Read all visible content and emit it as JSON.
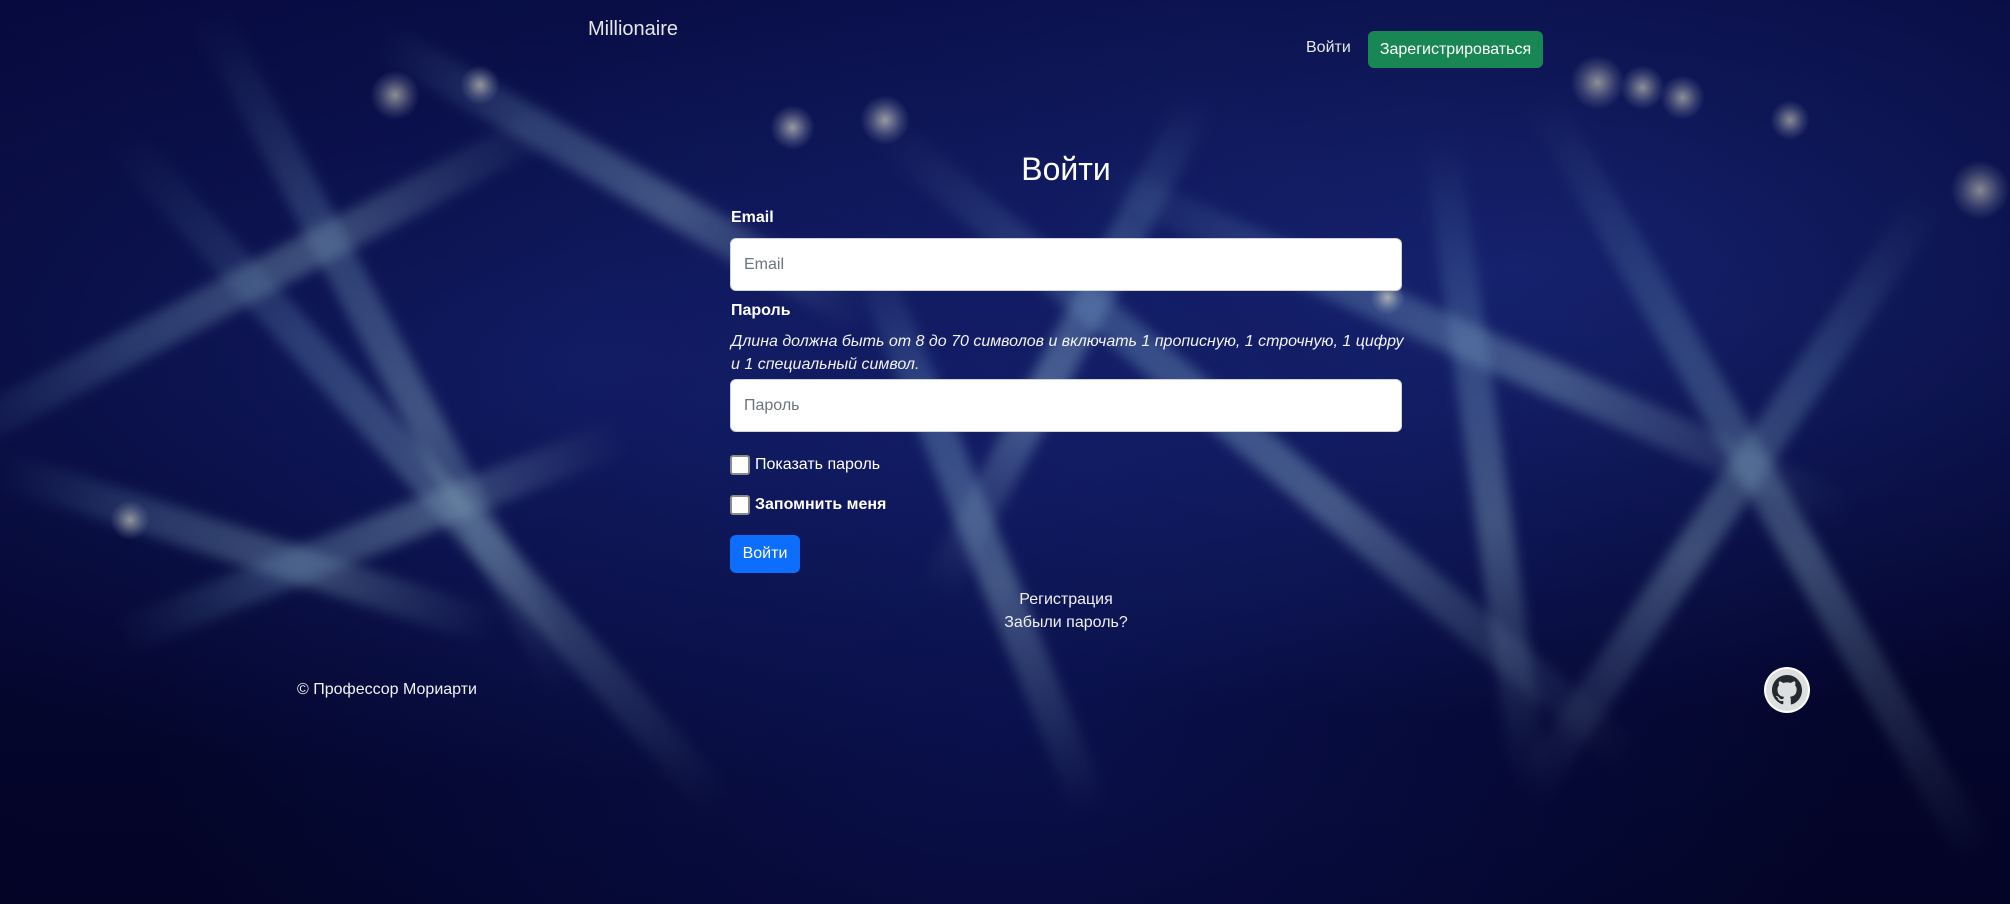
{
  "header": {
    "brand": "Millionaire",
    "login_link": "Войти",
    "register_button": "Зарегистрироваться"
  },
  "form": {
    "title": "Войти",
    "email_label": "Email",
    "email_placeholder": "Email",
    "email_value": "",
    "password_label": "Пароль",
    "password_hint": "Длина должна быть от 8 до 70 символов и включать 1 прописную, 1 строчную, 1 цифру и 1 специальный символ.",
    "password_placeholder": "Пароль",
    "password_value": "",
    "show_password_label": "Показать пароль",
    "show_password_checked": false,
    "remember_me_label": "Запомнить меня",
    "remember_me_checked": false,
    "submit_label": "Войти"
  },
  "links": {
    "register": "Регистрация",
    "forgot_password": "Забыли пароль?"
  },
  "footer": {
    "copyright": "© Профессор Мориарти",
    "github_icon": "github-icon"
  },
  "colors": {
    "register_button": "#198754",
    "submit_button": "#0d6efd",
    "background": "#05062e"
  }
}
